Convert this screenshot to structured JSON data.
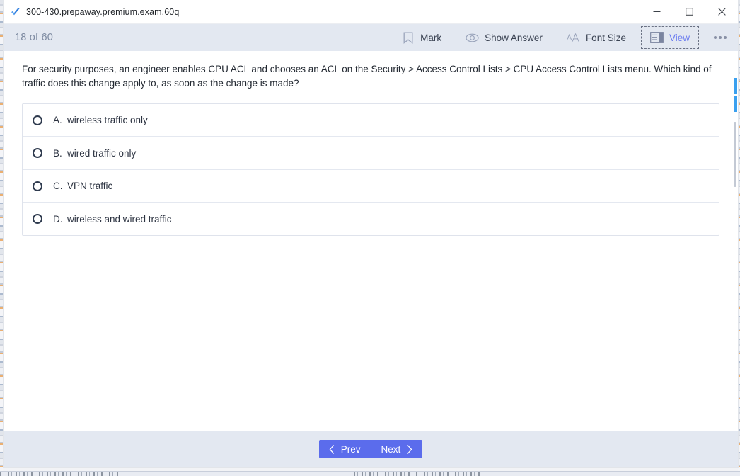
{
  "window": {
    "title": "300-430.prepaway.premium.exam.60q",
    "logo_icon": "blue-checkmark-icon",
    "controls": {
      "minimize": "minimize-icon",
      "maximize": "maximize-icon",
      "close": "close-icon"
    }
  },
  "toolbar": {
    "counter": "18 of 60",
    "items": [
      {
        "label": "Mark",
        "icon": "bookmark-icon",
        "focused": false
      },
      {
        "label": "Show Answer",
        "icon": "eye-icon",
        "focused": false
      },
      {
        "label": "Font Size",
        "icon": "font-size-aa-icon",
        "focused": false
      },
      {
        "label": "View",
        "icon": "view-layout-icon",
        "focused": true
      }
    ],
    "more_label": "more-options",
    "accent_focus_color": "#6b7cf0",
    "background_color": "#e3e8f1"
  },
  "question": {
    "text": "For security purposes, an engineer enables CPU ACL and chooses an ACL on the Security > Access Control Lists > CPU Access Control Lists menu. Which kind of traffic does this change apply to, as soon as the change is made?"
  },
  "options": [
    {
      "letter": "A.",
      "text": "wireless traffic only",
      "selected": false
    },
    {
      "letter": "B.",
      "text": "wired traffic only",
      "selected": false
    },
    {
      "letter": "C.",
      "text": "VPN traffic",
      "selected": false
    },
    {
      "letter": "D.",
      "text": "wireless and wired traffic",
      "selected": false
    }
  ],
  "footer": {
    "prev_label": "Prev",
    "next_label": "Next",
    "prev_icon": "chevron-left-icon",
    "next_icon": "chevron-right-icon",
    "button_color": "#5b6cec"
  }
}
